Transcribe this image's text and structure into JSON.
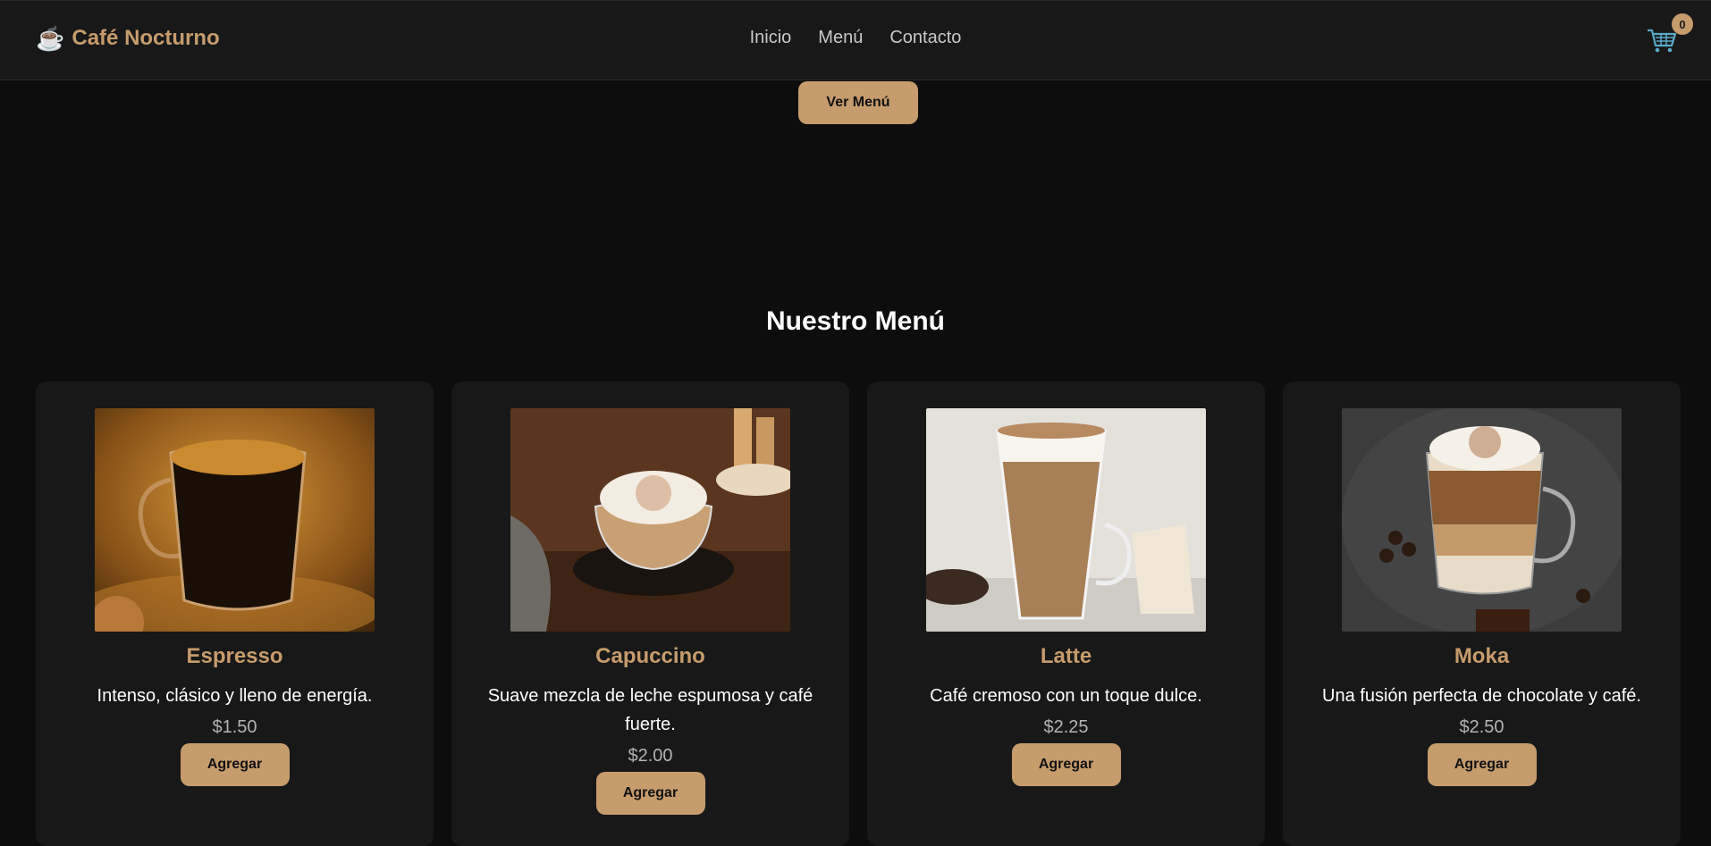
{
  "header": {
    "logo_icon": "☕",
    "logo_text": "Café Nocturno",
    "nav": [
      {
        "label": "Inicio"
      },
      {
        "label": "Menú"
      },
      {
        "label": "Contacto"
      }
    ],
    "cart_icon": "cart-icon",
    "cart_count": "0"
  },
  "hero": {
    "button_label": "Ver Menú"
  },
  "menu": {
    "title": "Nuestro Menú",
    "items": [
      {
        "name": "Espresso",
        "description": "Intenso, clásico y lleno de energía.",
        "price": "$1.50",
        "button": "Agregar"
      },
      {
        "name": "Capuccino",
        "description": "Suave mezcla de leche espumosa y café fuerte.",
        "price": "$2.00",
        "button": "Agregar"
      },
      {
        "name": "Latte",
        "description": "Café cremoso con un toque dulce.",
        "price": "$2.25",
        "button": "Agregar"
      },
      {
        "name": "Moka",
        "description": "Una fusión perfecta de chocolate y café.",
        "price": "$2.50",
        "button": "Agregar"
      }
    ]
  },
  "colors": {
    "accent": "#c69c6d",
    "background": "#0d0d0d",
    "surface": "#181818"
  }
}
